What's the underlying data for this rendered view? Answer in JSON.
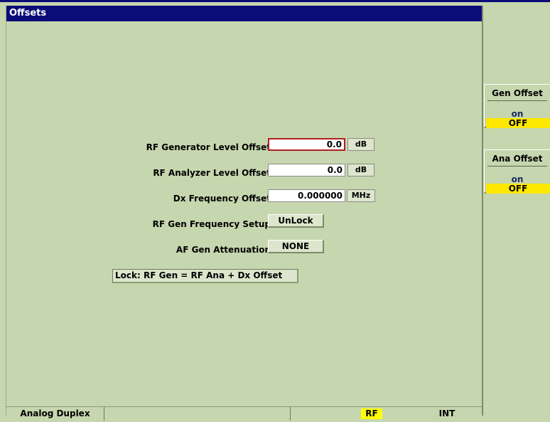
{
  "window": {
    "title": "Offsets"
  },
  "fields": {
    "rf_gen_level": {
      "label": "RF Generator Level Offset",
      "value": "0.0",
      "unit": "dB"
    },
    "rf_ana_level": {
      "label": "RF Analyzer Level Offset",
      "value": "0.0",
      "unit": "dB"
    },
    "dx_freq": {
      "label": "Dx Frequency Offset",
      "value": "0.000000",
      "unit": "MHz"
    },
    "rf_gen_freq_setup": {
      "label": "RF Gen Frequency Setup",
      "value": "UnLock"
    },
    "af_gen_atten": {
      "label": "AF Gen Attenuation",
      "value": "NONE"
    }
  },
  "note": "Lock: RF Gen = RF Ana + Dx Offset",
  "softkeys": [
    {
      "title": "Gen Offset",
      "on_label": "on",
      "off_label": "OFF",
      "selected": "OFF"
    },
    {
      "title": "Ana Offset",
      "on_label": "on",
      "off_label": "OFF",
      "selected": "OFF"
    }
  ],
  "status": {
    "mode": "Analog Duplex",
    "rf": "RF",
    "int": "INT"
  },
  "colors": {
    "title_bg": "#0c0c78",
    "panel_bg": "#c6d6ae",
    "highlight": "#ffe800",
    "active_border": "#b02020"
  }
}
